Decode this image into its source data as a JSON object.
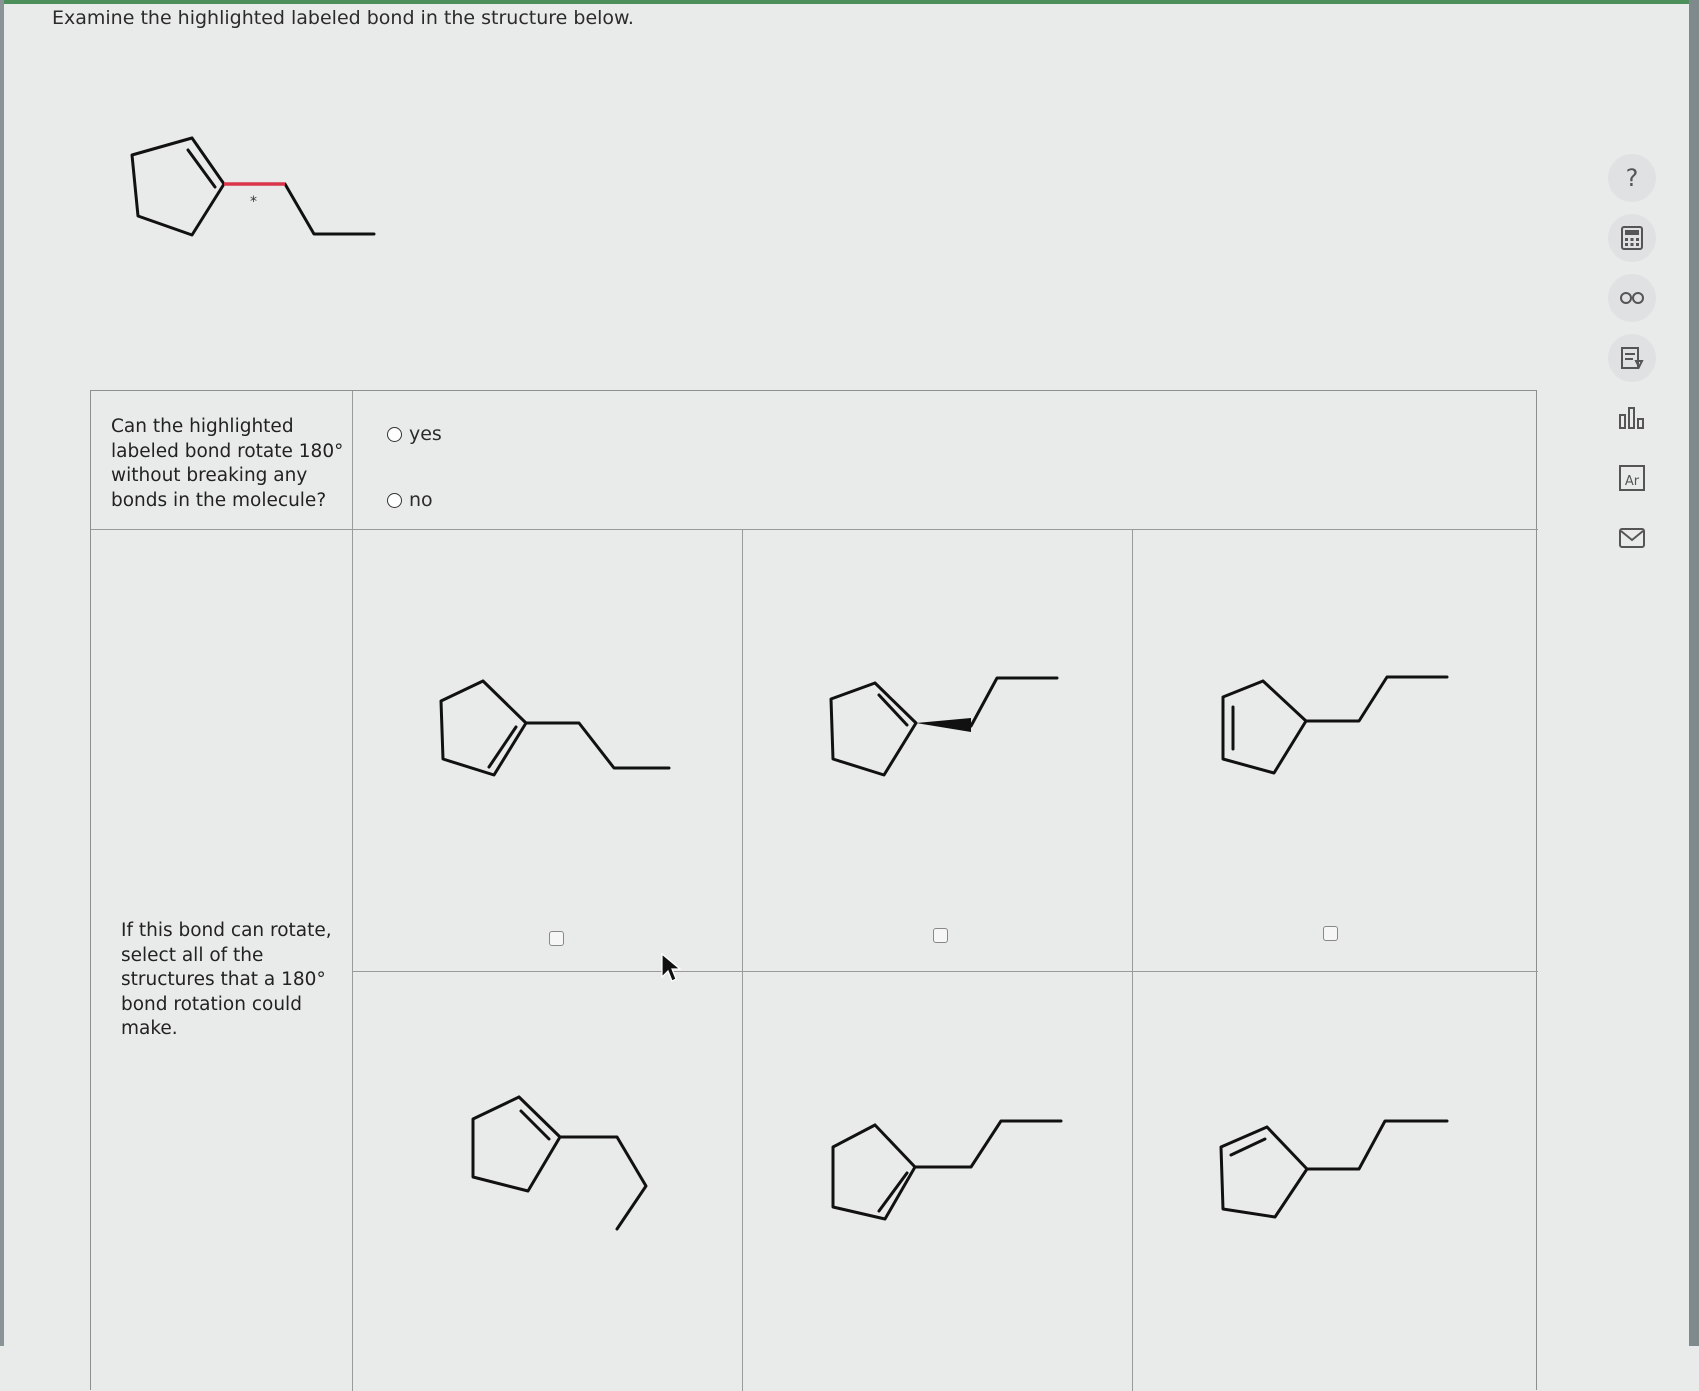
{
  "question": {
    "prompt": "Examine the highlighted labeled bond in the structure below.",
    "bond_label": "*",
    "q1_text": "Can the highlighted labeled bond rotate 180° without breaking any bonds in the molecule?",
    "options": [
      {
        "label": "yes",
        "selected": false
      },
      {
        "label": "no",
        "selected": false
      }
    ],
    "q2_text": "If this bond can rotate, select all of the structures that a 180° bond rotation could make."
  },
  "choices": [
    {
      "index": 1,
      "checked": false
    },
    {
      "index": 2,
      "checked": false
    },
    {
      "index": 3,
      "checked": false
    },
    {
      "index": 4,
      "checked": false
    },
    {
      "index": 5,
      "checked": false
    },
    {
      "index": 6,
      "checked": false
    }
  ],
  "toolbar": {
    "items": [
      {
        "icon": "help-icon",
        "glyph": "?"
      },
      {
        "icon": "calculator-icon"
      },
      {
        "icon": "glasses-icon"
      },
      {
        "icon": "notes-icon"
      },
      {
        "icon": "chart-icon"
      },
      {
        "icon": "periodic-table-icon",
        "glyph": "Ar"
      },
      {
        "icon": "mail-icon"
      }
    ]
  },
  "colors": {
    "highlight_bond": "#d9364a",
    "structure": "#111111"
  }
}
